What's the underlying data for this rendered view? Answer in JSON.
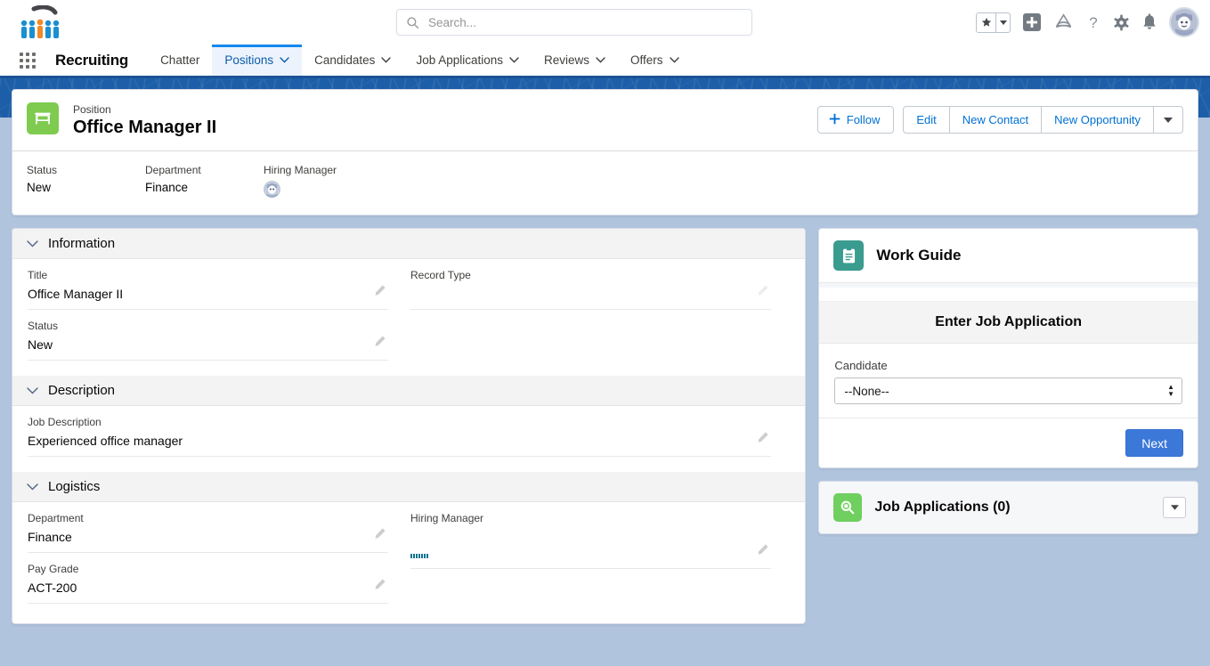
{
  "header": {
    "app_logo_alt": "recruiting-logo",
    "search": {
      "placeholder": "Search...",
      "value": ""
    },
    "icons": [
      {
        "name": "favorites-star-icon",
        "glyph": "★"
      },
      {
        "name": "favorites-dropdown-icon",
        "glyph": "▼"
      },
      {
        "name": "add-icon",
        "glyph": "+"
      },
      {
        "name": "trailhead-icon",
        "glyph": "▲"
      },
      {
        "name": "help-icon",
        "glyph": "?"
      },
      {
        "name": "setup-gear-icon",
        "glyph": "⚙"
      },
      {
        "name": "notifications-bell-icon",
        "glyph": "🔔"
      },
      {
        "name": "user-avatar",
        "glyph": ""
      }
    ]
  },
  "nav": {
    "app_name": "Recruiting",
    "tabs": [
      {
        "label": "Chatter",
        "has_menu": false,
        "active": false
      },
      {
        "label": "Positions",
        "has_menu": true,
        "active": true
      },
      {
        "label": "Candidates",
        "has_menu": true,
        "active": false
      },
      {
        "label": "Job Applications",
        "has_menu": true,
        "active": false
      },
      {
        "label": "Reviews",
        "has_menu": true,
        "active": false
      },
      {
        "label": "Offers",
        "has_menu": true,
        "active": false
      }
    ]
  },
  "record": {
    "object_label": "Position",
    "title": "Office Manager II",
    "actions": {
      "follow": "Follow",
      "edit": "Edit",
      "new_contact": "New Contact",
      "new_opportunity": "New Opportunity",
      "more": "▼"
    },
    "highlights": [
      {
        "label": "Status",
        "value": "New",
        "type": "text"
      },
      {
        "label": "Department",
        "value": "Finance",
        "type": "text"
      },
      {
        "label": "Hiring Manager",
        "value": "",
        "type": "avatar"
      }
    ]
  },
  "details": {
    "sections": [
      {
        "title": "Information",
        "left": [
          {
            "label": "Title",
            "value": "Office Manager II",
            "editable": true
          },
          {
            "label": "Status",
            "value": "New",
            "editable": true
          }
        ],
        "right": [
          {
            "label": "Record Type",
            "value": "",
            "editable": false
          }
        ]
      },
      {
        "title": "Description",
        "full": [
          {
            "label": "Job Description",
            "value": "Experienced office manager",
            "editable": true
          }
        ]
      },
      {
        "title": "Logistics",
        "left": [
          {
            "label": "Department",
            "value": "Finance",
            "editable": true
          },
          {
            "label": "Pay Grade",
            "value": "ACT-200",
            "editable": true
          }
        ],
        "right": [
          {
            "label": "Hiring Manager",
            "value": "",
            "editable": true,
            "link_stub": true
          }
        ]
      }
    ]
  },
  "work_guide": {
    "title": "Work Guide",
    "section_title": "Enter Job Application",
    "field_label": "Candidate",
    "field_value": "--None--",
    "next_label": "Next"
  },
  "related": {
    "job_applications_title": "Job Applications (0)"
  },
  "colors": {
    "brand_blue": "#1b5297",
    "link_blue": "#0070d2",
    "active_tab_bg": "#ecf3fc",
    "position_icon_green": "#7ecb50",
    "work_guide_teal": "#3a9b8f",
    "job_app_green": "#6fcf5f",
    "next_button_blue": "#3c78d8",
    "page_background": "#b0c4de"
  }
}
